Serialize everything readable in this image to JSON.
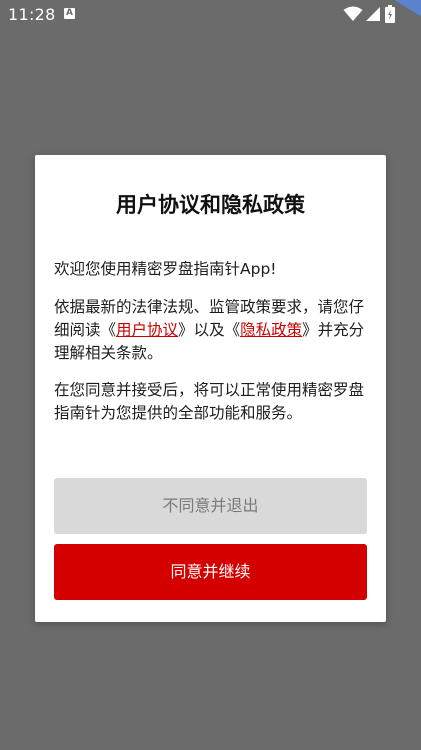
{
  "status_bar": {
    "time": "11:28",
    "notification_icon": "A",
    "icons": [
      "wifi-icon",
      "signal-icon",
      "battery-icon"
    ]
  },
  "dialog": {
    "title": "用户协议和隐私政策",
    "para1": "欢迎您使用精密罗盘指南针App!",
    "para2_before": "依据最新的法律法规、监管政策要求，请您仔细阅读",
    "para2_link1": "用户协议",
    "para2_middle": "以及",
    "para2_link2": "隐私政策",
    "para2_after": "并充分理解相关条款。",
    "para3": "在您同意并接受后，将可以正常使用精密罗盘指南针为您提供的全部功能和服务。",
    "disagree_label": "不同意并退出",
    "agree_label": "同意并继续"
  },
  "colors": {
    "overlay": "#6b6b6b",
    "link": "#cc0000",
    "agree_button": "#d40000",
    "disagree_button": "#d9d9d9"
  }
}
